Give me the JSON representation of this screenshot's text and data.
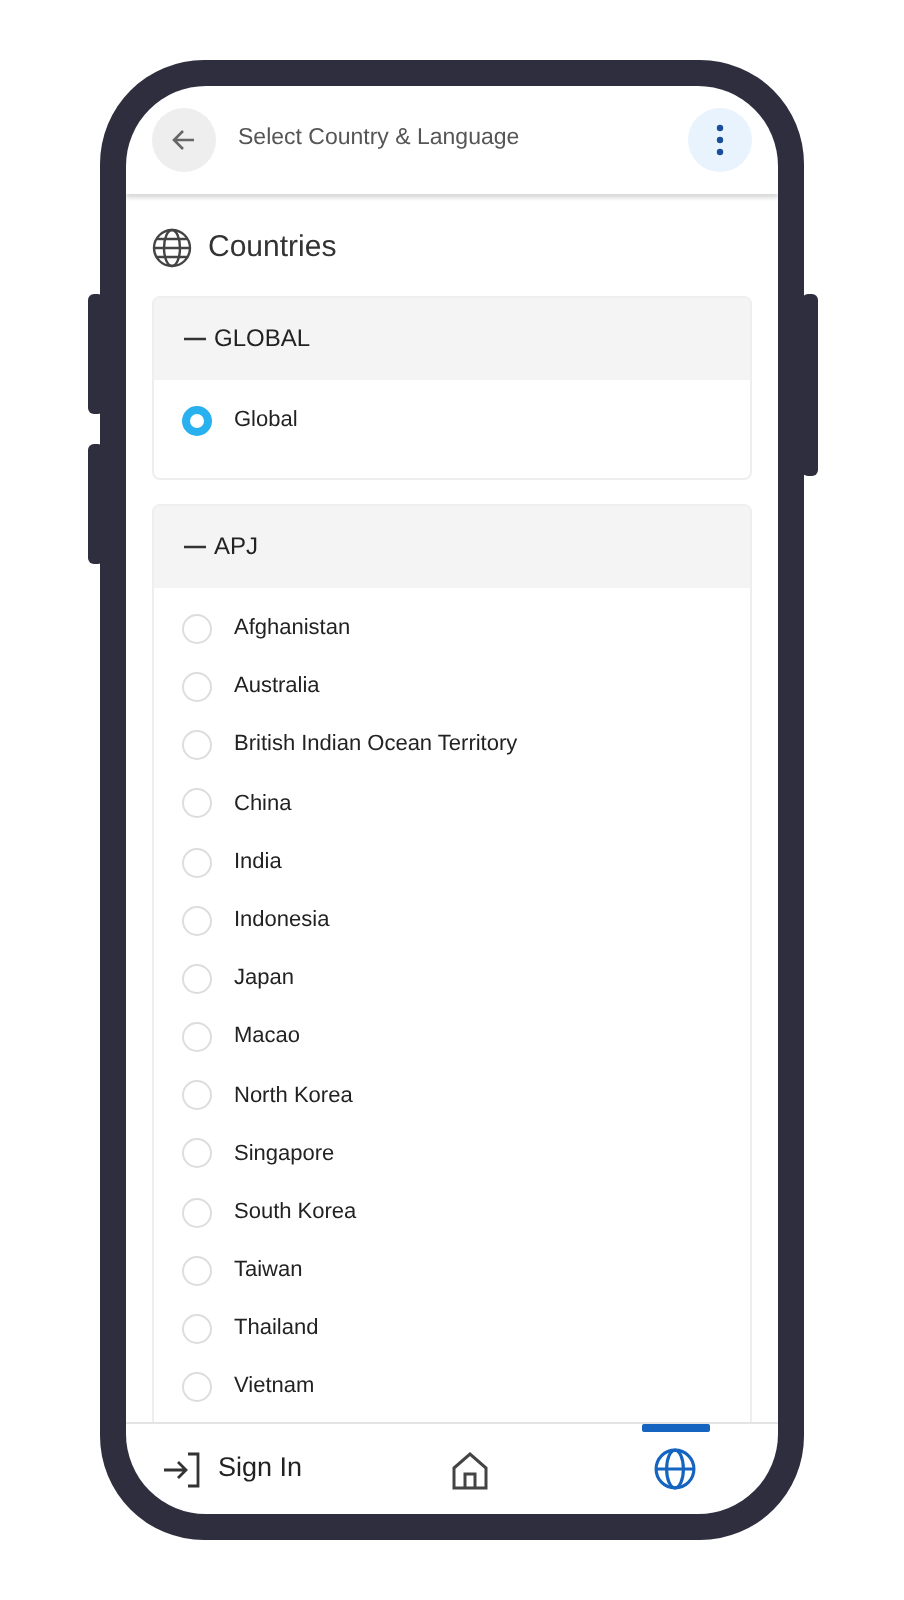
{
  "header": {
    "title": "Select Country & Language"
  },
  "section": {
    "title": "Countries"
  },
  "groups": [
    {
      "title": "GLOBAL",
      "expanded": true,
      "countries": [
        {
          "name": "Global",
          "selected": true
        }
      ]
    },
    {
      "title": "APJ",
      "expanded": true,
      "countries": [
        {
          "name": "Afghanistan",
          "selected": false
        },
        {
          "name": "Australia",
          "selected": false
        },
        {
          "name": "British Indian Ocean Territory",
          "selected": false
        },
        {
          "name": "China",
          "selected": false
        },
        {
          "name": "India",
          "selected": false
        },
        {
          "name": "Indonesia",
          "selected": false
        },
        {
          "name": "Japan",
          "selected": false
        },
        {
          "name": "Macao",
          "selected": false
        },
        {
          "name": "North Korea",
          "selected": false
        },
        {
          "name": "Singapore",
          "selected": false
        },
        {
          "name": "South Korea",
          "selected": false
        },
        {
          "name": "Taiwan",
          "selected": false
        },
        {
          "name": "Thailand",
          "selected": false
        },
        {
          "name": "Vietnam",
          "selected": false
        }
      ]
    }
  ],
  "bottom_nav": [
    {
      "kind": "signin",
      "label": "Sign In",
      "selected": false
    },
    {
      "kind": "home",
      "selected": false
    },
    {
      "kind": "globe",
      "selected": true
    }
  ]
}
